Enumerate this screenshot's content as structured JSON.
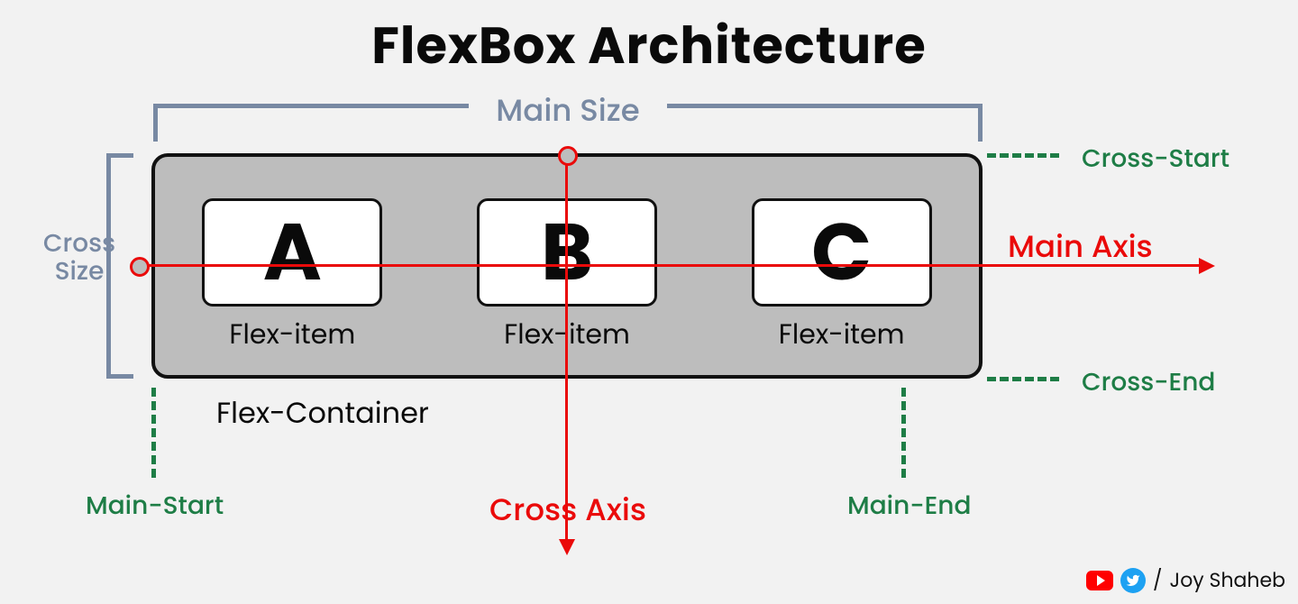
{
  "title": "FlexBox Architecture",
  "brackets": {
    "main_size": "Main Size",
    "cross_size_l1": "Cross",
    "cross_size_l2": "Size"
  },
  "container": {
    "label": "Flex-Container",
    "items": [
      {
        "letter": "A",
        "caption": "Flex-item"
      },
      {
        "letter": "B",
        "caption": "Flex-item"
      },
      {
        "letter": "C",
        "caption": "Flex-item"
      }
    ]
  },
  "axes": {
    "main": "Main Axis",
    "cross": "Cross Axis"
  },
  "markers": {
    "cross_start": "Cross-Start",
    "cross_end": "Cross-End",
    "main_start": "Main-Start",
    "main_end": "Main-End"
  },
  "credit": {
    "sep": "/",
    "author": "Joy Shaheb"
  },
  "colors": {
    "slate": "#7889a3",
    "green": "#1e7d46",
    "red": "#ea0a0a"
  }
}
